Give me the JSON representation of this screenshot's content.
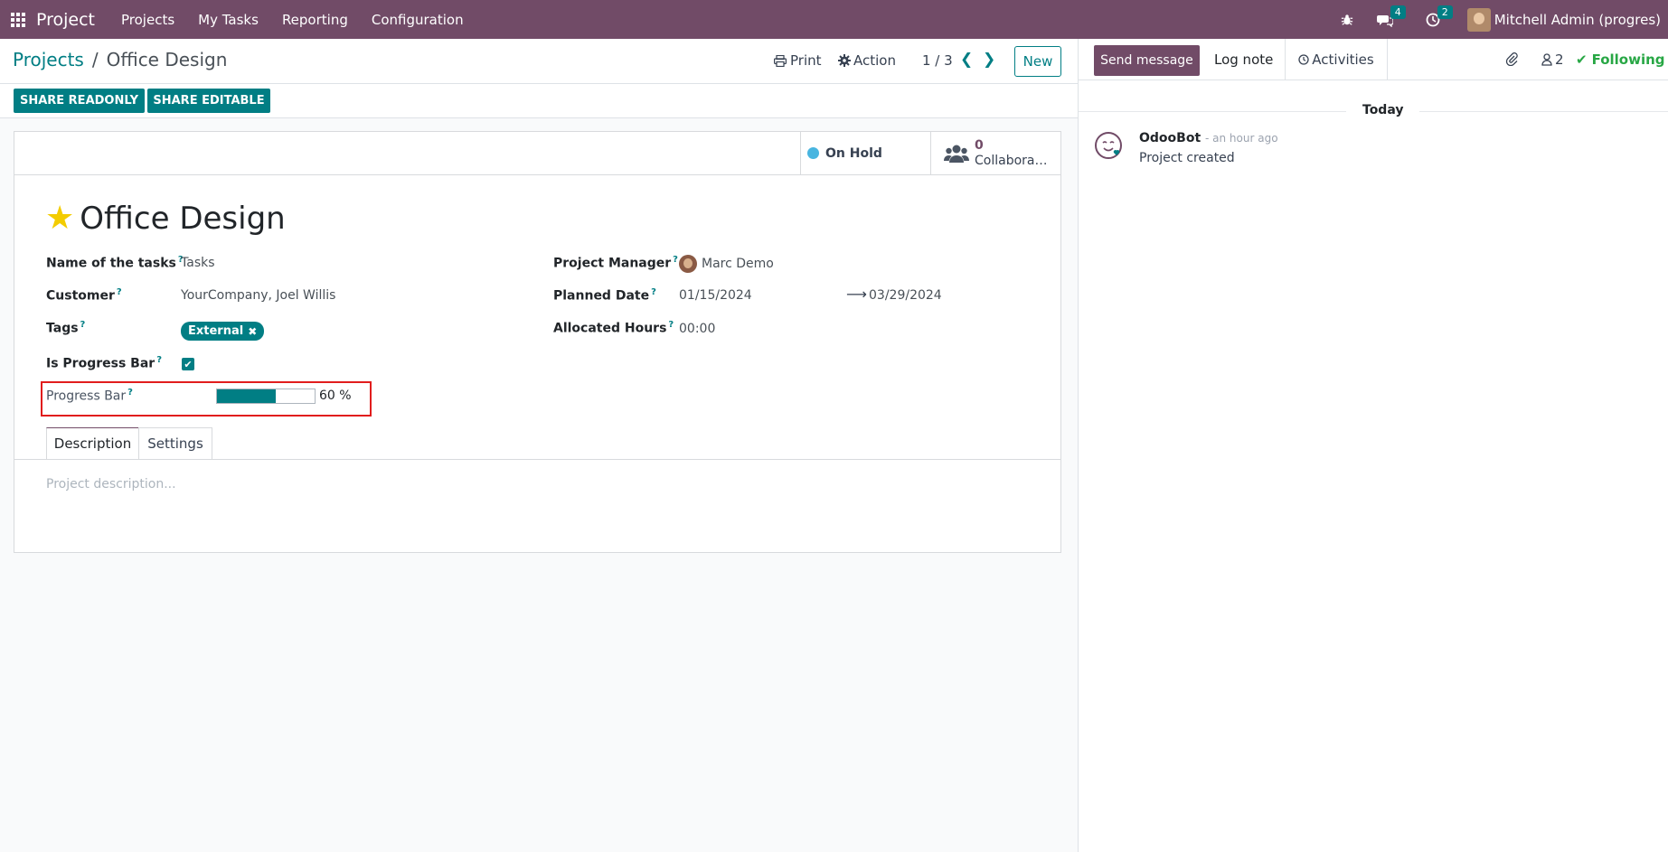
{
  "navbar": {
    "brand": "Project",
    "menu": [
      "Projects",
      "My Tasks",
      "Reporting",
      "Configuration"
    ],
    "messages_count": "4",
    "activities_count": "2",
    "user_name": "Mitchell Admin (progres)"
  },
  "control_panel": {
    "breadcrumb_parent": "Projects",
    "breadcrumb_sep": "/",
    "breadcrumb_current": "Office Design",
    "print_label": "Print",
    "action_label": "Action",
    "pager": "1 / 3",
    "new_label": "New"
  },
  "buttons": {
    "share_readonly": "SHARE READONLY",
    "share_editable": "SHARE EDITABLE"
  },
  "stat_buttons": {
    "status": "On Hold",
    "collaborators_count": "0",
    "collaborators_label": "Collabora…"
  },
  "form": {
    "title": "Office Design",
    "fields": {
      "tasks_label": "Name of the tasks",
      "tasks_value": "Tasks",
      "customer_label": "Customer",
      "customer_value": "YourCompany, Joel Willis",
      "tags_label": "Tags",
      "tag": "External",
      "is_progress_label": "Is Progress Bar",
      "progress_label": "Progress Bar",
      "progress_value": 60,
      "progress_text": "60 %",
      "manager_label": "Project Manager",
      "manager_value": "Marc Demo",
      "planned_label": "Planned Date",
      "planned_start": "01/15/2024",
      "planned_end": "03/29/2024",
      "allocated_label": "Allocated Hours",
      "allocated_value": "00:00"
    },
    "help_mark": "?",
    "tabs": [
      "Description",
      "Settings"
    ],
    "description_placeholder": "Project description..."
  },
  "chatter": {
    "send_message": "Send message",
    "log_note": "Log note",
    "activities": "Activities",
    "followers_count": "2",
    "following": "Following",
    "today": "Today",
    "message": {
      "author": "OdooBot",
      "time": "- an hour ago",
      "body": "Project created"
    }
  },
  "colors": {
    "brand": "#714b67",
    "accent": "#017e84",
    "status_on_hold": "#48b5e0",
    "star": "#f3cc00",
    "following": "#28a745",
    "highlight": "#e11d1d"
  }
}
